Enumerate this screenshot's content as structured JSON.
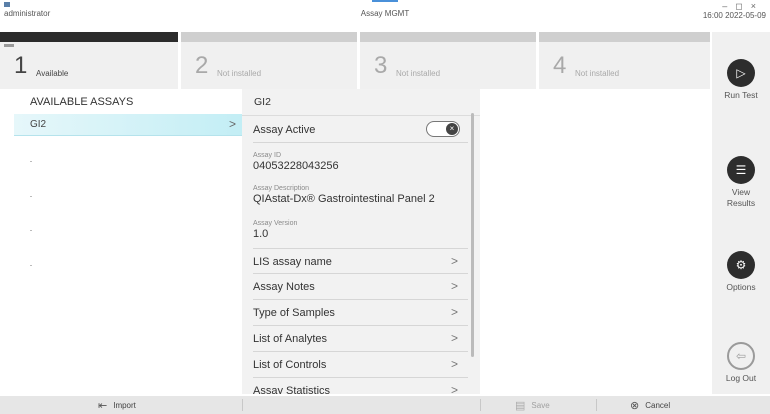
{
  "window": {
    "user": "administrator",
    "title": "Assay MGMT",
    "controls": "– ◻ ×",
    "datetime": "16:00 2022-05-09"
  },
  "modules": [
    {
      "number": "1",
      "status": "Available"
    },
    {
      "number": "2",
      "status": "Not installed"
    },
    {
      "number": "3",
      "status": "Not installed"
    },
    {
      "number": "4",
      "status": "Not installed"
    }
  ],
  "sidebar": {
    "run_test": "Run Test",
    "view_results": "View\nResults",
    "options": "Options",
    "log_out": "Log Out"
  },
  "assay_list": {
    "title": "AVAILABLE ASSAYS",
    "items": [
      {
        "name": "GI2"
      }
    ]
  },
  "detail": {
    "title": "GI2",
    "assay_active_label": "Assay Active",
    "assay_active": false,
    "assay_id_caption": "Assay ID",
    "assay_id": "04053228043256",
    "assay_description_caption": "Assay Description",
    "assay_description": "QIAstat-Dx® Gastrointestinal Panel 2",
    "assay_version_caption": "Assay Version",
    "assay_version": "1.0",
    "rows": [
      "LIS assay name",
      "Assay Notes",
      "Type of Samples",
      "List of Analytes",
      "List of Controls",
      "Assay Statistics"
    ]
  },
  "bottom_bar": {
    "import": "Import",
    "save": "Save",
    "cancel": "Cancel"
  }
}
